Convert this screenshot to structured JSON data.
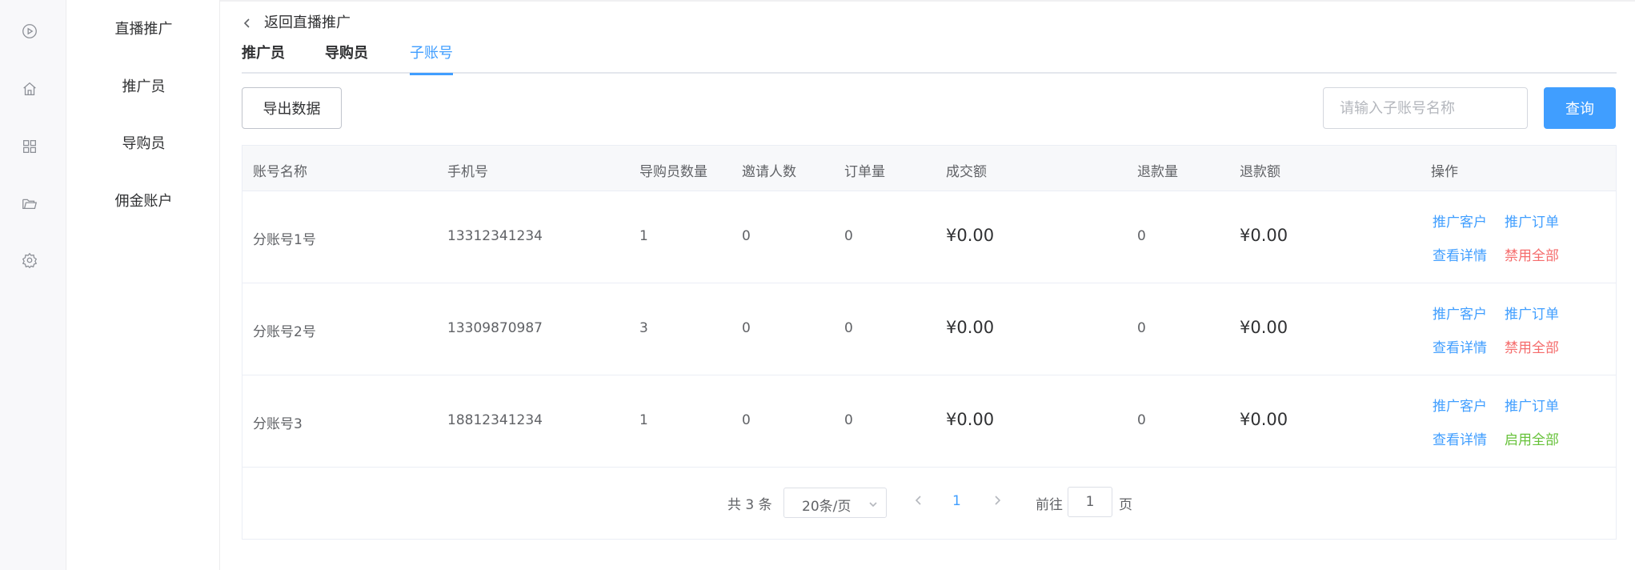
{
  "rail": {
    "icons": [
      "play-circle-icon",
      "home-icon",
      "grid-icon",
      "folder-icon",
      "gear-icon"
    ]
  },
  "subnav": {
    "items": [
      "直播推广",
      "推广员",
      "导购员",
      "佣金账户"
    ]
  },
  "header": {
    "back_label": "返回直播推广",
    "tabs": [
      "推广员",
      "导购员",
      "子账号"
    ],
    "active_tab": "子账号"
  },
  "toolbar": {
    "export_label": "导出数据",
    "search_placeholder": "请输入子账号名称",
    "search_value": "",
    "query_label": "查询"
  },
  "table": {
    "columns": [
      "账号名称",
      "手机号",
      "导购员数量",
      "邀请人数",
      "订单量",
      "成交额",
      "退款量",
      "退款额",
      "操作"
    ],
    "rows": [
      {
        "name": "分账号1号",
        "phone": "13312341234",
        "guides": "1",
        "invites": "0",
        "orders": "0",
        "amount": "¥0.00",
        "refunds": "0",
        "refund_amount": "¥0.00",
        "ops": [
          "推广客户",
          "推广订单",
          "查看详情",
          "禁用全部"
        ],
        "toggle_state": "disable"
      },
      {
        "name": "分账号2号",
        "phone": "13309870987",
        "guides": "3",
        "invites": "0",
        "orders": "0",
        "amount": "¥0.00",
        "refunds": "0",
        "refund_amount": "¥0.00",
        "ops": [
          "推广客户",
          "推广订单",
          "查看详情",
          "禁用全部"
        ],
        "toggle_state": "disable"
      },
      {
        "name": "分账号3",
        "phone": "18812341234",
        "guides": "1",
        "invites": "0",
        "orders": "0",
        "amount": "¥0.00",
        "refunds": "0",
        "refund_amount": "¥0.00",
        "ops": [
          "推广客户",
          "推广订单",
          "查看详情",
          "启用全部"
        ],
        "toggle_state": "enable"
      }
    ]
  },
  "pagination": {
    "total_label": "共 3 条",
    "page_size_label": "20条/页",
    "current_page": "1",
    "goto_label": "前往",
    "goto_value": "1",
    "page_suffix": "页"
  },
  "colors": {
    "accent": "#409eff",
    "danger": "#f56c6c",
    "success": "#67c23a"
  }
}
